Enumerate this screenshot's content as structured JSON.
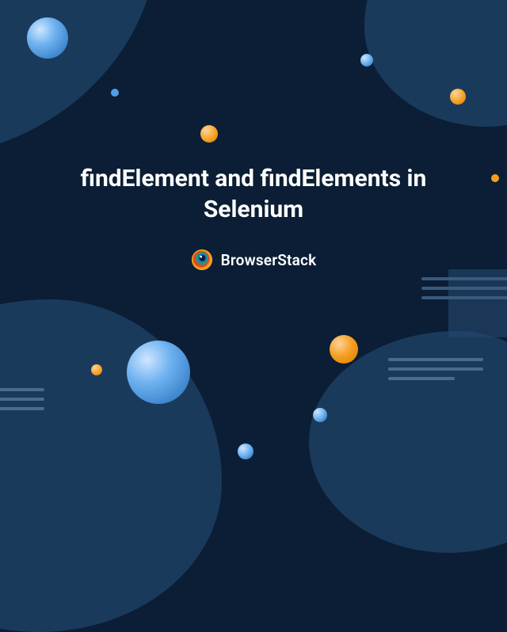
{
  "title": "findElement and findElements in Selenium",
  "brand": {
    "name": "BrowserStack",
    "logo_label": "browserstack-logo"
  },
  "colors": {
    "bg_dark": "#0b1e35",
    "blob": "#1a3a5c",
    "orange": "#f59e1e",
    "blue_light": "#6fb2f0",
    "text": "#ffffff"
  }
}
